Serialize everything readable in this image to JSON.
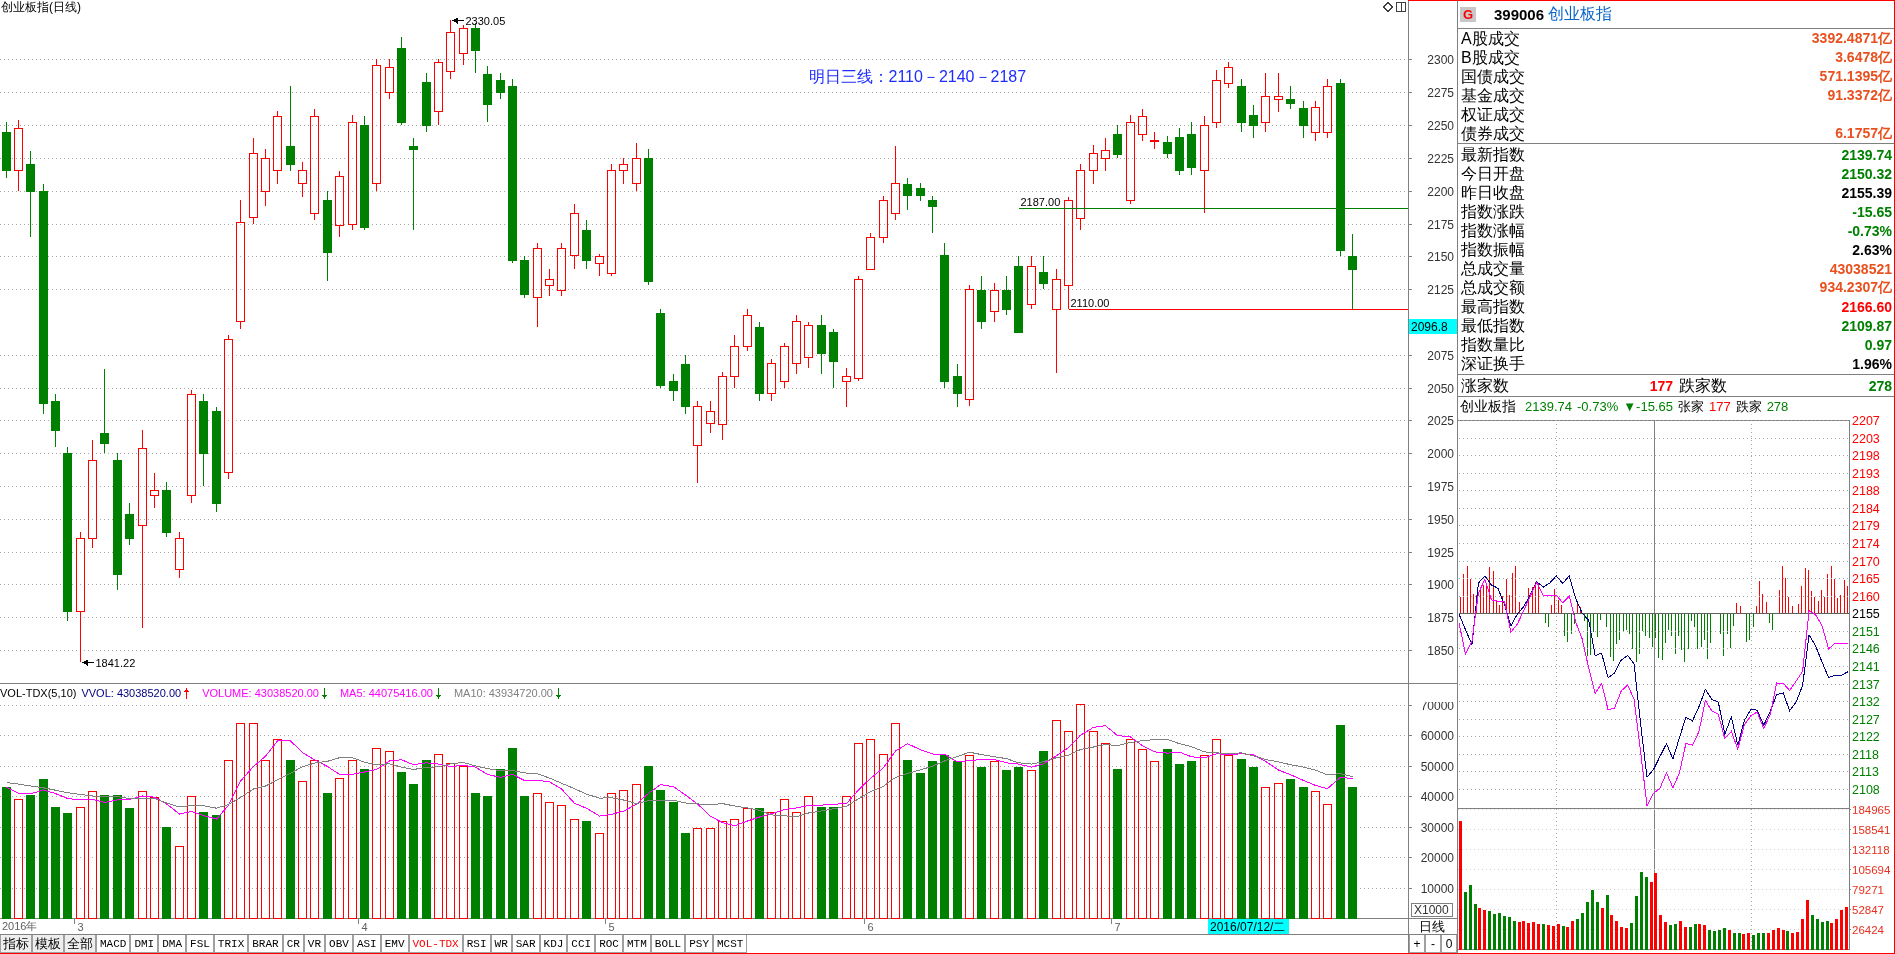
{
  "price_chart": {
    "title": "创业板指(日线)",
    "chart_data": {
      "type": "candlestick",
      "grid": true,
      "ylim": [
        1824.85,
        2345.34
      ],
      "yticks": [
        1850,
        1875,
        1900,
        1925,
        1950,
        1975,
        2000,
        2025,
        2050,
        2075,
        2125,
        2150,
        2175,
        2200,
        2225,
        2250,
        2275,
        2300
      ],
      "categories": [
        null,
        null,
        null,
        null,
        null,
        null,
        null,
        null,
        null,
        null,
        null,
        null,
        null,
        null,
        null,
        null,
        null,
        null,
        null,
        null,
        null,
        null,
        null,
        null,
        null,
        null,
        null,
        null,
        null,
        null,
        null,
        null,
        null,
        null,
        null,
        null,
        null,
        null,
        null,
        null,
        null,
        null,
        null,
        null,
        null,
        null,
        null,
        null,
        null,
        null,
        null,
        null,
        null,
        null,
        null,
        null,
        null,
        null,
        null,
        null,
        null,
        null,
        null,
        null,
        null,
        null,
        null,
        null,
        null,
        null,
        null,
        null,
        null,
        null,
        null,
        null,
        null,
        null,
        null,
        null,
        null,
        null,
        null,
        null,
        null,
        null,
        null,
        null,
        null,
        null,
        null,
        null,
        null,
        null,
        null,
        null,
        null,
        null,
        null,
        null,
        null,
        null,
        null,
        null,
        null,
        null,
        null,
        null,
        null,
        null,
        null,
        null,
        null,
        null
      ],
      "ohlc": [
        [
          2245,
          2252,
          2210,
          2216
        ],
        [
          2216,
          2254,
          2200,
          2248
        ],
        [
          2220,
          2230,
          2165,
          2200
        ],
        [
          2200,
          2205,
          2030,
          2038
        ],
        [
          2040,
          2045,
          2005,
          2018
        ],
        [
          2000,
          2005,
          1872,
          1880
        ],
        [
          1880,
          1940,
          1841,
          1935
        ],
        [
          1935,
          2010,
          1928,
          1995
        ],
        [
          2015,
          2064,
          2000,
          2008
        ],
        [
          1995,
          2000,
          1896,
          1908
        ],
        [
          1954,
          1962,
          1930,
          1935
        ],
        [
          1945,
          2018,
          1867,
          2004
        ],
        [
          1968,
          1985,
          1958,
          1972
        ],
        [
          1972,
          1978,
          1936,
          1940
        ],
        [
          1912,
          1940,
          1905,
          1935
        ],
        [
          1968,
          2048,
          1962,
          2045
        ],
        [
          2040,
          2045,
          1975,
          2000
        ],
        [
          2032,
          2035,
          1955,
          1962
        ],
        [
          1986,
          2090,
          1980,
          2087
        ],
        [
          2101,
          2193,
          2095,
          2176
        ],
        [
          2180,
          2240,
          2175,
          2229
        ],
        [
          2200,
          2232,
          2188,
          2225
        ],
        [
          2216,
          2261,
          2205,
          2257
        ],
        [
          2234,
          2280,
          2215,
          2220
        ],
        [
          2206,
          2222,
          2195,
          2216
        ],
        [
          2183,
          2262,
          2178,
          2257
        ],
        [
          2193,
          2200,
          2131,
          2153
        ],
        [
          2174,
          2215,
          2165,
          2211
        ],
        [
          2175,
          2258,
          2170,
          2252
        ],
        [
          2250,
          2257,
          2170,
          2172
        ],
        [
          2206,
          2300,
          2200,
          2296
        ],
        [
          2275,
          2300,
          2270,
          2294
        ],
        [
          2309,
          2317,
          2250,
          2252
        ],
        [
          2234,
          2240,
          2170,
          2232
        ],
        [
          2283,
          2290,
          2245,
          2250
        ],
        [
          2261,
          2300,
          2250,
          2298
        ],
        [
          2291,
          2330,
          2285,
          2321
        ],
        [
          2305,
          2326,
          2296,
          2324
        ],
        [
          2324,
          2328,
          2290,
          2307
        ],
        [
          2289,
          2295,
          2252,
          2266
        ],
        [
          2284,
          2290,
          2270,
          2275
        ],
        [
          2280,
          2285,
          2145,
          2147
        ],
        [
          2147,
          2150,
          2118,
          2121
        ],
        [
          2119,
          2160,
          2096,
          2156
        ],
        [
          2128,
          2140,
          2120,
          2133
        ],
        [
          2124,
          2160,
          2120,
          2156
        ],
        [
          2151,
          2190,
          2140,
          2183
        ],
        [
          2170,
          2178,
          2140,
          2147
        ],
        [
          2145,
          2152,
          2135,
          2150
        ],
        [
          2137,
          2220,
          2135,
          2216
        ],
        [
          2216,
          2225,
          2205,
          2220
        ],
        [
          2206,
          2236,
          2200,
          2225
        ],
        [
          2225,
          2232,
          2128,
          2131
        ],
        [
          2107,
          2110,
          2050,
          2052
        ],
        [
          2055,
          2060,
          2040,
          2048
        ],
        [
          2068,
          2075,
          2030,
          2036
        ],
        [
          2006,
          2040,
          1977,
          2036
        ],
        [
          2023,
          2040,
          2015,
          2032
        ],
        [
          2022,
          2062,
          2010,
          2059
        ],
        [
          2059,
          2090,
          2050,
          2082
        ],
        [
          2082,
          2110,
          2078,
          2105
        ],
        [
          2096,
          2100,
          2040,
          2046
        ],
        [
          2046,
          2072,
          2040,
          2069
        ],
        [
          2055,
          2084,
          2050,
          2082
        ],
        [
          2069,
          2105,
          2060,
          2101
        ],
        [
          2073,
          2100,
          2065,
          2098
        ],
        [
          2098,
          2105,
          2060,
          2076
        ],
        [
          2092,
          2095,
          2050,
          2070
        ],
        [
          2055,
          2065,
          2035,
          2059
        ],
        [
          2057,
          2135,
          2055,
          2133
        ],
        [
          2140,
          2168,
          2140,
          2165
        ],
        [
          2165,
          2196,
          2160,
          2193
        ],
        [
          2183,
          2234,
          2178,
          2206
        ],
        [
          2205,
          2210,
          2185,
          2197
        ],
        [
          2202,
          2206,
          2192,
          2197
        ],
        [
          2193,
          2196,
          2168,
          2188
        ],
        [
          2151,
          2160,
          2050,
          2055
        ],
        [
          2059,
          2068,
          2035,
          2046
        ],
        [
          2041,
          2128,
          2036,
          2125
        ],
        [
          2124,
          2135,
          2095,
          2101
        ],
        [
          2108,
          2130,
          2100,
          2124
        ],
        [
          2124,
          2135,
          2105,
          2110
        ],
        [
          2143,
          2150,
          2092,
          2092
        ],
        [
          2114,
          2150,
          2110,
          2143
        ],
        [
          2138,
          2150,
          2125,
          2130
        ],
        [
          2110,
          2140,
          2061,
          2133
        ],
        [
          2128,
          2195,
          2110,
          2193
        ],
        [
          2179,
          2220,
          2170,
          2216
        ],
        [
          2216,
          2235,
          2205,
          2229
        ],
        [
          2225,
          2240,
          2215,
          2231
        ],
        [
          2243,
          2250,
          2225,
          2228
        ],
        [
          2193,
          2258,
          2190,
          2252
        ],
        [
          2243,
          2262,
          2238,
          2257
        ],
        [
          2238,
          2245,
          2232,
          2239
        ],
        [
          2237,
          2242,
          2225,
          2229
        ],
        [
          2241,
          2248,
          2212,
          2216
        ],
        [
          2243,
          2252,
          2212,
          2218
        ],
        [
          2216,
          2257,
          2183,
          2250
        ],
        [
          2252,
          2292,
          2248,
          2284
        ],
        [
          2282,
          2298,
          2278,
          2294
        ],
        [
          2280,
          2285,
          2245,
          2252
        ],
        [
          2258,
          2265,
          2240,
          2250
        ],
        [
          2252,
          2290,
          2245,
          2272
        ],
        [
          2270,
          2290,
          2260,
          2272
        ],
        [
          2270,
          2280,
          2262,
          2267
        ],
        [
          2263,
          2268,
          2240,
          2250
        ],
        [
          2245,
          2268,
          2238,
          2264
        ],
        [
          2245,
          2285,
          2240,
          2280
        ],
        [
          2282,
          2285,
          2150,
          2155
        ],
        [
          2150,
          2167,
          2110,
          2140
        ],
        null,
        null,
        null,
        null
      ],
      "ref_lines": [
        {
          "axis": "y",
          "value": 2187,
          "label": "2187.00",
          "color": "#008000"
        },
        {
          "axis": "y",
          "value": 2110,
          "label": "2110.00",
          "color": "#ff0000"
        }
      ],
      "annotations": [
        "2330.05",
        "1841.22",
        "明日三线：2110－2140－2187",
        "2096.8"
      ]
    }
  },
  "volume_chart": {
    "title": "VOL-TDX(5,10)",
    "legend": [
      {
        "text": "VVOL: 43038520.00",
        "color": "#000080",
        "rising": true
      },
      {
        "text": "VOLUME: 43038520.00",
        "color": "#ff00ff",
        "rising": false
      },
      {
        "text": "MA5: 44075416.00",
        "color": "#ff00ff",
        "rising": false
      },
      {
        "text": "MA10: 43934720.00",
        "color": "#808080",
        "rising": false
      }
    ],
    "unit": "X1000",
    "year_label": "2016年",
    "chart_data": {
      "type": "bar",
      "grid": true,
      "ylim": [
        0,
        71000
      ],
      "yticks": [
        10000,
        20000,
        30000,
        40000,
        50000,
        60000,
        70000
      ],
      "categories": [
        null,
        null,
        null,
        null,
        null,
        null,
        "3",
        null,
        null,
        null,
        null,
        null,
        null,
        null,
        null,
        null,
        null,
        null,
        null,
        null,
        null,
        null,
        null,
        null,
        null,
        null,
        null,
        null,
        null,
        "4",
        null,
        null,
        null,
        null,
        null,
        null,
        null,
        null,
        null,
        null,
        null,
        null,
        null,
        null,
        null,
        null,
        null,
        null,
        null,
        "5",
        null,
        null,
        null,
        null,
        null,
        null,
        null,
        null,
        null,
        null,
        null,
        null,
        null,
        null,
        null,
        null,
        null,
        null,
        null,
        null,
        "6",
        null,
        null,
        null,
        null,
        null,
        null,
        null,
        null,
        null,
        null,
        null,
        null,
        null,
        null,
        null,
        null,
        null,
        null,
        null,
        "7",
        null,
        null,
        null,
        null,
        null,
        null,
        null,
        null,
        null,
        null,
        null,
        null,
        null,
        null,
        null,
        null,
        null,
        null,
        null,
        null,
        null,
        null,
        null
      ],
      "series": [
        {
          "type": "bar",
          "values": [
            43000,
            39000,
            40500,
            45700,
            36500,
            34600,
            36500,
            41700,
            40500,
            40500,
            36000,
            41700,
            39700,
            29800,
            23800,
            40000,
            35000,
            34000,
            52000,
            64000,
            64000,
            52000,
            59000,
            52000,
            45000,
            52000,
            41000,
            46000,
            52000,
            49000,
            56000,
            55000,
            48000,
            44000,
            52000,
            54000,
            51000,
            50000,
            41000,
            40000,
            49000,
            56000,
            40000,
            41000,
            38000,
            37000,
            32600,
            32000,
            28000,
            41000,
            42000,
            44000,
            50000,
            42000,
            38000,
            28000,
            29500,
            29500,
            32000,
            32500,
            36000,
            36000,
            35000,
            39000,
            35000,
            40000,
            36500,
            36500,
            40000,
            57600,
            59000,
            54000,
            64000,
            52000,
            47700,
            51700,
            53600,
            51700,
            53600,
            49700,
            51700,
            48500,
            49700,
            48500,
            55000,
            65000,
            61600,
            70300,
            61600,
            57600,
            49000,
            59000,
            55600,
            51700,
            55600,
            50500,
            51700,
            53600,
            58800,
            53600,
            52400,
            49700,
            43000,
            44500,
            45700,
            43000,
            41700,
            37400,
            63600,
            43000,
            null,
            null,
            null,
            null
          ],
          "colors": [
            "#008000",
            "#ff0000",
            "#008000",
            "#008000",
            "#008000",
            "#008000",
            "#ff0000",
            "#ff0000",
            "#008000",
            "#008000",
            "#008000",
            "#ff0000",
            "#ff0000",
            "#008000",
            "#ff0000",
            "#ff0000",
            "#008000",
            "#008000",
            "#ff0000",
            "#ff0000",
            "#ff0000",
            "#ff0000",
            "#ff0000",
            "#008000",
            "#ff0000",
            "#ff0000",
            "#008000",
            "#ff0000",
            "#ff0000",
            "#008000",
            "#ff0000",
            "#ff0000",
            "#008000",
            "#008000",
            "#008000",
            "#ff0000",
            "#ff0000",
            "#ff0000",
            "#008000",
            "#008000",
            "#008000",
            "#008000",
            "#008000",
            "#ff0000",
            "#ff0000",
            "#ff0000",
            "#ff0000",
            "#008000",
            "#ff0000",
            "#ff0000",
            "#ff0000",
            "#ff0000",
            "#008000",
            "#008000",
            "#008000",
            "#008000",
            "#ff0000",
            "#ff0000",
            "#ff0000",
            "#ff0000",
            "#ff0000",
            "#008000",
            "#ff0000",
            "#ff0000",
            "#ff0000",
            "#ff0000",
            "#008000",
            "#008000",
            "#ff0000",
            "#ff0000",
            "#ff0000",
            "#ff0000",
            "#ff0000",
            "#008000",
            "#008000",
            "#008000",
            "#008000",
            "#008000",
            "#ff0000",
            "#008000",
            "#ff0000",
            "#008000",
            "#008000",
            "#ff0000",
            "#008000",
            "#ff0000",
            "#ff0000",
            "#ff0000",
            "#ff0000",
            "#ff0000",
            "#008000",
            "#ff0000",
            "#ff0000",
            "#ff0000",
            "#008000",
            "#008000",
            "#008000",
            "#ff0000",
            "#ff0000",
            "#ff0000",
            "#008000",
            "#008000",
            "#ff0000",
            "#ff0000",
            "#008000",
            "#008000",
            "#ff0000",
            "#ff0000",
            "#008000",
            "#008000",
            null,
            null,
            null,
            null
          ]
        },
        {
          "type": "line",
          "color": "#ff00ff",
          "values": [
            43000,
            41000,
            40800,
            42100,
            40900,
            39300,
            38800,
            39000,
            38000,
            38800,
            39000,
            40100,
            39700,
            37500,
            34200,
            35000,
            33700,
            32500,
            37000,
            45000,
            49800,
            53200,
            58200,
            58200,
            54400,
            52000,
            49800,
            47200,
            47200,
            48000,
            48800,
            51600,
            52000,
            50400,
            51000,
            50600,
            49800,
            50200,
            49600,
            47200,
            46200,
            47200,
            45200,
            45200,
            44800,
            42400,
            37700,
            36100,
            33500,
            34100,
            35100,
            37400,
            41000,
            43800,
            43200,
            40400,
            37500,
            33400,
            31400,
            30300,
            31900,
            33200,
            34300,
            35700,
            36200,
            37000,
            37100,
            37400,
            37600,
            42100,
            45900,
            49400,
            54900,
            57300,
            55300,
            53900,
            53800,
            51300,
            51700,
            52100,
            52100,
            51000,
            50600,
            49600,
            50700,
            53300,
            56000,
            60100,
            62700,
            63200,
            60000,
            59500,
            56600,
            54600,
            54200,
            54500,
            53000,
            52600,
            54000,
            53600,
            54000,
            53600,
            51500,
            48600,
            47100,
            45200,
            43600,
            42500,
            46300,
            45800,
            null,
            null,
            null,
            null
          ]
        },
        {
          "type": "line",
          "color": "#808080",
          "values": [
            44500,
            44000,
            43400,
            42800,
            42000,
            41200,
            40600,
            40100,
            39800,
            39900,
            39200,
            39400,
            39300,
            37800,
            36500,
            37000,
            36900,
            36100,
            37300,
            39600,
            42400,
            43400,
            45400,
            47600,
            49700,
            50900,
            51500,
            52700,
            52700,
            51200,
            50400,
            50700,
            49600,
            48800,
            49500,
            49700,
            50700,
            51100,
            50000,
            49100,
            48400,
            48500,
            47700,
            47400,
            46000,
            44300,
            42500,
            40700,
            39400,
            39500,
            38800,
            37600,
            38600,
            38700,
            38700,
            37800,
            37500,
            37200,
            37600,
            36800,
            36200,
            35400,
            33900,
            33600,
            33300,
            34500,
            35200,
            35900,
            36700,
            39200,
            41500,
            43300,
            46200,
            47500,
            48700,
            49900,
            51600,
            53100,
            54500,
            53700,
            53000,
            52400,
            51000,
            50600,
            51400,
            52700,
            53500,
            55400,
            56200,
            57000,
            56700,
            57700,
            58300,
            58600,
            58700,
            57300,
            56300,
            54600,
            54300,
            53900,
            54300,
            53300,
            52100,
            51300,
            50400,
            49600,
            48600,
            47000,
            47500,
            46400,
            null,
            null,
            null,
            null
          ]
        }
      ],
      "annotations": [
        "2016/07/12/二"
      ]
    }
  },
  "period_label": "日线",
  "zoom_buttons": [
    "+",
    "-",
    "0"
  ],
  "tool_buttons": [
    "指标",
    "模板",
    "全部"
  ],
  "indicator_tabs": [
    {
      "label": "MACD",
      "selected": false
    },
    {
      "label": "DMI",
      "selected": false
    },
    {
      "label": "DMA",
      "selected": false
    },
    {
      "label": "FSL",
      "selected": false
    },
    {
      "label": "TRIX",
      "selected": false
    },
    {
      "label": "BRAR",
      "selected": false
    },
    {
      "label": "CR",
      "selected": false
    },
    {
      "label": "VR",
      "selected": false
    },
    {
      "label": "OBV",
      "selected": false
    },
    {
      "label": "ASI",
      "selected": false
    },
    {
      "label": "EMV",
      "selected": false
    },
    {
      "label": "VOL-TDX",
      "selected": true
    },
    {
      "label": "RSI",
      "selected": false
    },
    {
      "label": "WR",
      "selected": false
    },
    {
      "label": "SAR",
      "selected": false
    },
    {
      "label": "KDJ",
      "selected": false
    },
    {
      "label": "CCI",
      "selected": false
    },
    {
      "label": "ROC",
      "selected": false
    },
    {
      "label": "MTM",
      "selected": false
    },
    {
      "label": "BOLL",
      "selected": false
    },
    {
      "label": "PSY",
      "selected": false
    },
    {
      "label": "MCST",
      "selected": false
    }
  ],
  "quote_panel": {
    "badge": "G",
    "code": "399006",
    "name": "创业板指",
    "turnover": [
      {
        "label": "A股成交",
        "value": "3392.4871亿",
        "color": "#e8501e"
      },
      {
        "label": "B股成交",
        "value": "3.6478亿",
        "color": "#e8501e"
      },
      {
        "label": "国债成交",
        "value": "571.1395亿",
        "color": "#e8501e"
      },
      {
        "label": "基金成交",
        "value": "91.3372亿",
        "color": "#e8501e"
      },
      {
        "label": "权证成交"
      },
      {
        "label": "债券成交",
        "value": "6.1757亿",
        "color": "#e8501e"
      }
    ],
    "index_stats": [
      {
        "label": "最新指数",
        "value": "2139.74",
        "color": "#008000"
      },
      {
        "label": "今日开盘",
        "value": "2150.32",
        "color": "#008000"
      },
      {
        "label": "昨日收盘",
        "value": "2155.39",
        "color": "#000000"
      },
      {
        "label": "指数涨跌",
        "value": "-15.65",
        "color": "#008000"
      },
      {
        "label": "指数涨幅",
        "value": "-0.73%",
        "color": "#008000"
      },
      {
        "label": "指数振幅",
        "value": "2.63%",
        "color": "#000000"
      },
      {
        "label": "总成交量",
        "value": "43038521",
        "color": "#e8501e"
      },
      {
        "label": "总成交额",
        "value": "934.2307亿",
        "color": "#e8501e"
      },
      {
        "label": "最高指数",
        "value": "2166.60",
        "color": "#ff0000"
      },
      {
        "label": "最低指数",
        "value": "2109.87",
        "color": "#008000"
      },
      {
        "label": "指数量比",
        "value": "0.97",
        "color": "#008000"
      },
      {
        "label": "深证换手",
        "value": "1.96%",
        "color": "#000000"
      }
    ],
    "breadth": {
      "up_label": "涨家数",
      "up_count": "177",
      "down_label": "跌家数",
      "down_count": "278"
    }
  },
  "intraday": {
    "header": [
      {
        "text": "创业板指"
      },
      {
        "text": "2139.74",
        "color": "#008000"
      },
      {
        "text": "-0.73%",
        "color": "#008000"
      },
      {
        "text": "▼-15.65",
        "color": "#008000"
      },
      {
        "text": "张家"
      },
      {
        "text": "177",
        "color": "#ff0000"
      },
      {
        "text": "跌家"
      },
      {
        "text": "278",
        "color": "#008000"
      }
    ],
    "chart_data": {
      "type": "line",
      "grid": true,
      "ylim": [
        2103.17,
        2207.22
      ],
      "yticks": [
        {
          "value": 2207.22,
          "label": "2207"
        },
        {
          "value": 2202.51,
          "label": "2203"
        },
        {
          "value": 2197.8,
          "label": "2198"
        },
        {
          "value": 2193.08,
          "label": "2193"
        },
        {
          "value": 2188.37,
          "label": "2188"
        },
        {
          "value": 2183.66,
          "label": "2184"
        },
        {
          "value": 2178.95,
          "label": "2179"
        },
        {
          "value": 2174.24,
          "label": "2174"
        },
        {
          "value": 2169.52,
          "label": "2170"
        },
        {
          "value": 2164.81,
          "label": "2165"
        },
        {
          "value": 2160.1,
          "label": "2160"
        },
        {
          "value": 2155.39,
          "label": "2155"
        },
        {
          "value": 2150.68,
          "label": "2151"
        },
        {
          "value": 2145.97,
          "label": "2146"
        },
        {
          "value": 2141.25,
          "label": "2141"
        },
        {
          "value": 2136.54,
          "label": "2137"
        },
        {
          "value": 2131.83,
          "label": "2132"
        },
        {
          "value": 2127.12,
          "label": "2127"
        },
        {
          "value": 2122.4,
          "label": "2122"
        },
        {
          "value": 2117.69,
          "label": "2118"
        },
        {
          "value": 2112.98,
          "label": "2113"
        },
        {
          "value": 2108.27,
          "label": "2108"
        }
      ],
      "series": [
        {
          "color": "#000080",
          "values": [
            2155.2,
            2151,
            2147,
            2163.5,
            2165.4,
            2163,
            2162.1,
            2157.8,
            2152,
            2155.2,
            2157.2,
            2160.3,
            2163.8,
            2162.4,
            2163.5,
            2165.4,
            2163.4,
            2165.4,
            2159.3,
            2155.4,
            2153.5,
            2144,
            2144.7,
            2138.1,
            2139.4,
            2142.8,
            2144.1,
            2141.8,
            2126,
            2111.4,
            2113.5,
            2117,
            2120.4,
            2116.3,
            2122,
            2127.5,
            2126.5,
            2130.3,
            2135,
            2132.3,
            2131.6,
            2123,
            2127.6,
            2120,
            2126.6,
            2129.6,
            2129.4,
            2125.4,
            2129,
            2133.6,
            2134,
            2129.3,
            2131.6,
            2136,
            2149.6,
            2146.6,
            2142.3,
            2138.1,
            2138.8,
            2138.8,
            2139.7
          ]
        },
        {
          "color": "#ff00ff",
          "values": [
            2152.8,
            2144.5,
            2148,
            2160.8,
            2164.5,
            2159,
            2158.6,
            2158.6,
            2150.3,
            2152.5,
            2156.2,
            2160,
            2163.7,
            2160.1,
            2160.2,
            2160.2,
            2158.2,
            2160,
            2153,
            2148.5,
            2140.7,
            2133.9,
            2136.5,
            2129.5,
            2130,
            2134.5,
            2136.2,
            2132.3,
            2118.5,
            2103.8,
            2107.1,
            2108.5,
            2112.6,
            2108.6,
            2112.5,
            2120.5,
            2120,
            2123.6,
            2132,
            2129.2,
            2128.3,
            2121.8,
            2123.7,
            2119,
            2125.4,
            2127.9,
            2128.9,
            2124.5,
            2128.2,
            2136.7,
            2136.6,
            2134.7,
            2137.2,
            2139.8,
            2156.1,
            2155,
            2152,
            2145.8,
            2147.4,
            2147.4,
            2147.4
          ]
        }
      ],
      "ref_lines": [
        {
          "axis": "y",
          "value": 2155.39,
          "color": "#606060"
        }
      ]
    },
    "volume": {
      "chart_data": {
        "type": "bar",
        "grid": true,
        "ylim": [
          0,
          184965
        ],
        "yticks": [
          26424,
          52847,
          79271,
          105694,
          132118,
          158541,
          184965
        ],
        "categories": [
          null,
          null,
          null,
          null,
          null,
          null,
          null,
          null,
          null,
          null,
          null,
          null,
          null,
          null,
          null,
          null,
          null,
          null,
          null,
          null,
          null,
          null,
          null,
          null,
          null,
          null,
          null,
          null,
          null,
          null,
          null,
          null,
          null,
          null,
          null,
          null,
          null,
          null,
          null,
          null,
          null,
          null,
          null,
          null,
          null,
          null,
          null,
          null,
          null,
          null,
          null,
          null,
          null,
          null,
          null,
          null,
          null,
          null,
          null,
          null,
          null,
          null,
          null,
          null,
          null,
          null,
          null,
          null,
          null,
          null,
          null,
          null,
          null,
          null,
          null,
          null,
          null,
          null,
          null,
          null
        ],
        "series": [
          {
            "values": [
              168000,
              75000,
              85000,
              60000,
              55000,
              52000,
              50000,
              46000,
              48000,
              44000,
              42000,
              38000,
              36000,
              37000,
              35000,
              36000,
              34000,
              33000,
              32000,
              31000,
              33000,
              31000,
              30000,
              38000,
              40000,
              48000,
              62000,
              78000,
              62000,
              55000,
              72000,
              45000,
              38000,
              30000,
              28000,
              35000,
              70000,
              102000,
              95000,
              88000,
              100000,
              45000,
              36000,
              32000,
              33000,
              38000,
              30000,
              29000,
              33000,
              34000,
              32000,
              26000,
              24000,
              25000,
              28000,
              26000,
              22000,
              22000,
              20000,
              21000,
              19000,
              22000,
              21000,
              22000,
              26000,
              28000,
              25000,
              24000,
              22000,
              23000,
              40000,
              65000,
              45000,
              40000,
              36000,
              38000,
              35000,
              40000,
              52000,
              56000
            ]
          }
        ]
      }
    }
  }
}
